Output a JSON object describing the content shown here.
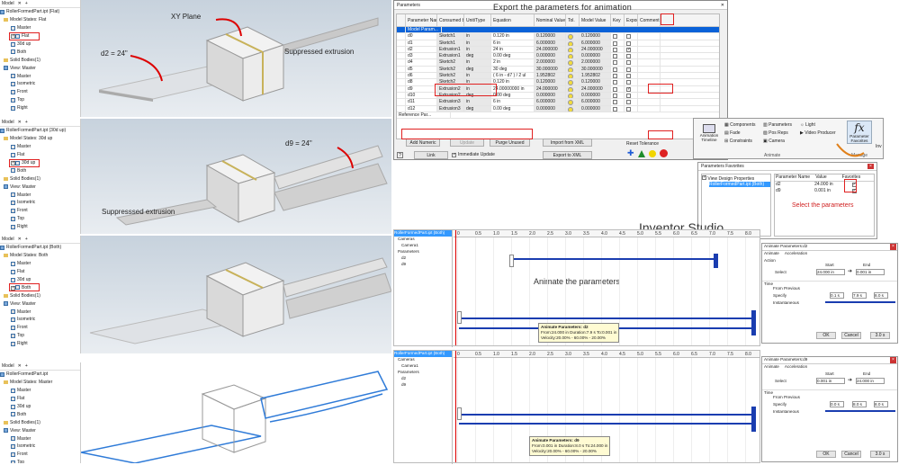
{
  "quadrants": [
    {
      "tab": "Model",
      "file": "RollerFormedPart.ipt (Flat)",
      "model_states_label": "Model States: Flat",
      "items": [
        "Master",
        "Flat",
        "30d up",
        "Both"
      ],
      "selected": "Flat",
      "solid_bodies": "Solid Bodies(1)",
      "view": "View: Master",
      "views": [
        "Master",
        "Isometric",
        "Front",
        "Top",
        "Right"
      ]
    },
    {
      "tab": "Model",
      "file": "RollerFormedPart.ipt (30d up)",
      "model_states_label": "Model States: 30d up",
      "items": [
        "Master",
        "Flat",
        "30d up",
        "Both"
      ],
      "selected": "30d up",
      "solid_bodies": "Solid Bodies(1)",
      "view": "View: Master",
      "views": [
        "Master",
        "Isometric",
        "Front",
        "Top",
        "Right"
      ]
    },
    {
      "tab": "Model",
      "file": "RollerFormedPart.ipt (Both)",
      "model_states_label": "Model States: Both",
      "items": [
        "Master",
        "Flat",
        "30d up",
        "Both"
      ],
      "selected": "Both",
      "solid_bodies": "Solid Bodies(1)",
      "view": "View: Master",
      "views": [
        "Master",
        "Isometric",
        "Front",
        "Top",
        "Right"
      ]
    },
    {
      "tab": "Model",
      "file": "RollerFormedPart.ipt",
      "model_states_label": "Model States: Master",
      "items": [
        "Master",
        "Flat",
        "30d up",
        "Both"
      ],
      "selected": "",
      "solid_bodies": "Solid Bodies(1)",
      "view": "View: Master",
      "views": [
        "Master",
        "Isometric",
        "Front",
        "Top"
      ]
    }
  ],
  "annotations": {
    "xy_plane": "XY Plane",
    "d2": "d2 = 24\"",
    "suppressed1": "Suppressed extrusion",
    "d9": "d9 = 24\"",
    "suppressed2": "Suppresssed extrusion",
    "export_title": "Export the parameters for animation",
    "inventor_studio": "Inventor Studio",
    "animate_params": "Animate the parameters",
    "select_params": "Select the parameters"
  },
  "param_dialog": {
    "title": "Parameters",
    "headers": [
      "Parameter Name",
      "Consumed by",
      "Unit/Type",
      "Equation",
      "Nominal Value",
      "Tol.",
      "Model Value",
      "Key",
      "Export",
      "Comment"
    ],
    "group": "Model Param...",
    "rows": [
      {
        "name": "d0",
        "by": "Sketch1",
        "unit": "in",
        "eq": "0.120 in",
        "nom": "0.120000",
        "model": "0.120000",
        "exp": false
      },
      {
        "name": "d1",
        "by": "Sketch1",
        "unit": "in",
        "eq": "6 in",
        "nom": "6.000000",
        "model": "6.000000",
        "exp": false
      },
      {
        "name": "d2",
        "by": "Extrusion1",
        "unit": "in",
        "eq": "24 in",
        "nom": "24.000000",
        "model": "24.000000",
        "exp": true
      },
      {
        "name": "d3",
        "by": "Extrusion1",
        "unit": "deg",
        "eq": "0.00 deg",
        "nom": "0.000000",
        "model": "0.000000",
        "exp": false
      },
      {
        "name": "d4",
        "by": "Sketch2",
        "unit": "in",
        "eq": "2 in",
        "nom": "2.000000",
        "model": "2.000000",
        "exp": false
      },
      {
        "name": "d5",
        "by": "Sketch2",
        "unit": "deg",
        "eq": "30 deg",
        "nom": "30.000000",
        "model": "30.000000",
        "exp": false
      },
      {
        "name": "d6",
        "by": "Sketch2",
        "unit": "in",
        "eq": "( 6 in - d7 ) / 2 ul",
        "nom": "1.952802",
        "model": "1.952802",
        "exp": false
      },
      {
        "name": "d8",
        "by": "Sketch2",
        "unit": "in",
        "eq": "0.120 in",
        "nom": "0.120000",
        "model": "0.120000",
        "exp": false
      },
      {
        "name": "d9",
        "by": "Extrusion2",
        "unit": "in",
        "eq": "24.00000000 in",
        "nom": "24.000000",
        "model": "24.000000",
        "exp": true
      },
      {
        "name": "d10",
        "by": "Extrusion2",
        "unit": "deg",
        "eq": "0.00 deg",
        "nom": "0.000000",
        "model": "0.000000",
        "exp": false
      },
      {
        "name": "d11",
        "by": "Extrusion3",
        "unit": "in",
        "eq": "6 in",
        "nom": "6.000000",
        "model": "6.000000",
        "exp": false
      },
      {
        "name": "d12",
        "by": "Extrusion3",
        "unit": "deg",
        "eq": "0.00 deg",
        "nom": "0.000000",
        "model": "0.000000",
        "exp": false
      }
    ],
    "ref_label": "Reference Par...",
    "add_numeric": "Add Numeric",
    "update": "Update",
    "purge": "Purge Unused",
    "import_xml": "Import from XML",
    "link": "Link",
    "immediate": "Immediate Update",
    "export_xml": "Export to XML",
    "reset_tol": "Reset Tolerance"
  },
  "ribbon": {
    "components": "Components",
    "parameters": "Parameters",
    "light": "Light",
    "anim_timeline": "Animation Timeline",
    "fade": "Fade",
    "pos_reps": "Pos Reps",
    "video_producer": "Video Producer",
    "constraints": "Constraints",
    "camera": "Camera",
    "param_favorites": "Parameter Favorites",
    "animate": "Animate",
    "manage": "Manage",
    "inv": "Inv"
  },
  "favorites": {
    "title": "Parameters Favorites",
    "tree_root": "View Design Properties",
    "tree_item": "RollerFormedPart.ipt (Both)",
    "headers": [
      "Parameter Name",
      "Value",
      "Favorites"
    ],
    "rows": [
      {
        "name": "d2",
        "value": "24.000 in",
        "fav": true
      },
      {
        "name": "d9",
        "value": "0.001 in",
        "fav": true
      }
    ]
  },
  "timeline": {
    "ticks": [
      "0",
      "0.5",
      "1.0",
      "1.5",
      "2.0",
      "2.5",
      "3.0",
      "3.5",
      "4.0",
      "4.5",
      "5.0",
      "5.5",
      "6.0",
      "6.5",
      "7.0",
      "7.5",
      "8.0"
    ],
    "tree": [
      "RollerFormedPart.ipt (Both)",
      "Cameras",
      "Camera1",
      "Parameters",
      "d2",
      "d9"
    ],
    "tip1": [
      "Animate Parameters: d2",
      "From:24.000 in  Duration:7.9 s  To:0.001 in",
      "Velocity:20.00% - 60.00% - 20.00%"
    ],
    "tip2": [
      "Animate Parameters: d9",
      "From:0.001 in  Duration:8.0 s  To:24.000 in",
      "Velocity:20.00% - 60.00% - 20.00%"
    ]
  },
  "anim_dlg1": {
    "title": "Animate Parameters:d2",
    "tabs": [
      "Animate",
      "Acceleration"
    ],
    "action": "Action",
    "select": "Select",
    "start_label": "Start",
    "end_label": "End",
    "start": "24.000 in",
    "end": "0.001 in",
    "time": "Time",
    "from_prev": "From Previous",
    "specify": "Specify",
    "instant": "Instantaneous",
    "t_start": "0.1 s",
    "duration": "7.9 s",
    "t_end": "8.0 s",
    "ok": "OK",
    "cancel": "Cancel",
    "spin": "3.0 s"
  },
  "anim_dlg2": {
    "title": "Animate Parameters:d9",
    "tabs": [
      "Animate",
      "Acceleration"
    ],
    "select": "Select",
    "start_label": "Start",
    "end_label": "End",
    "start": "0.001 in",
    "end": "24.000 in",
    "time": "Time",
    "from_prev": "From Previous",
    "specify": "Specify",
    "instant": "Instantaneous",
    "t_start": "0.0 s",
    "duration": "8.0 s",
    "t_end": "8.0 s",
    "ok": "OK",
    "cancel": "Cancel",
    "spin": "3.0 s"
  },
  "colors": {
    "accent": "#1a3db0",
    "red": "#e02020",
    "selected": "#3399ff"
  }
}
